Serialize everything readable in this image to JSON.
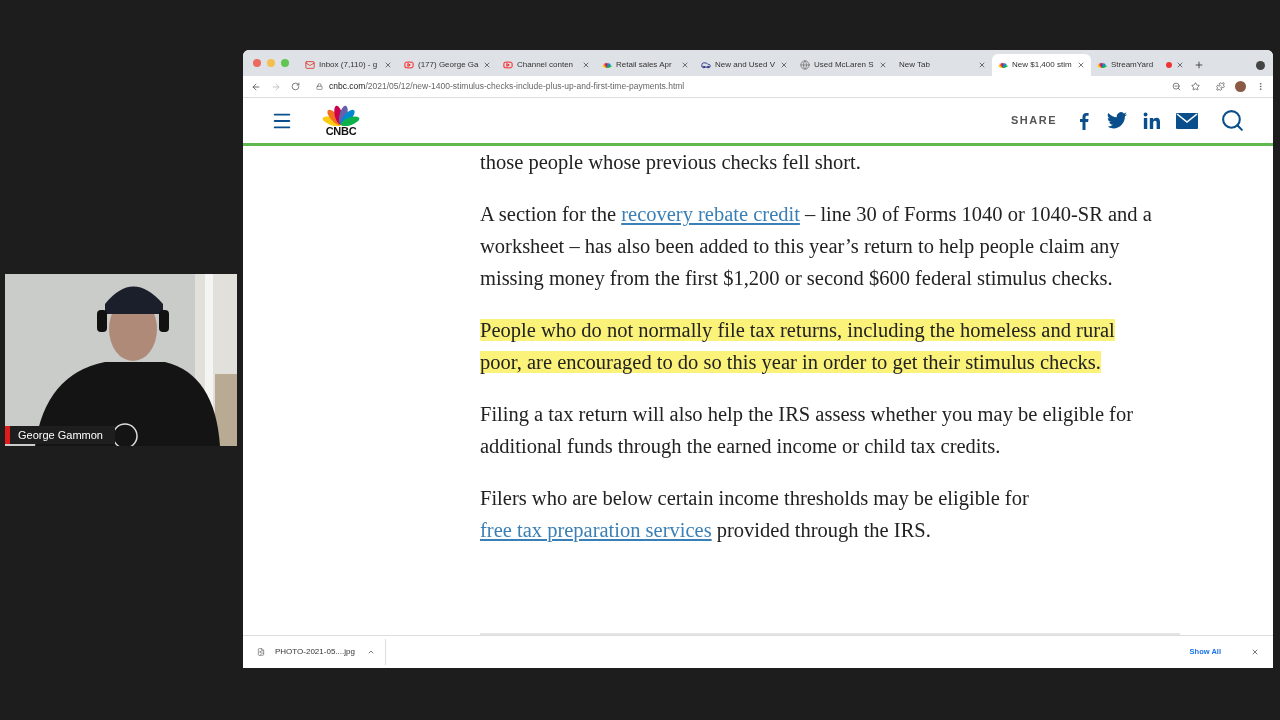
{
  "stream": {
    "presenter_name": "George Gammon"
  },
  "browser": {
    "tabs": [
      {
        "title": "Inbox (7,110) - g",
        "kind": "mail",
        "selected": false,
        "recording": false
      },
      {
        "title": "(177) George Ga",
        "kind": "video",
        "selected": false,
        "recording": false
      },
      {
        "title": "Channel conten",
        "kind": "video",
        "selected": false,
        "recording": false
      },
      {
        "title": "Retail sales Apr",
        "kind": "peacock",
        "selected": false,
        "recording": false
      },
      {
        "title": "New and Used V",
        "kind": "car",
        "selected": false,
        "recording": false
      },
      {
        "title": "Used McLaren S",
        "kind": "globe",
        "selected": false,
        "recording": false
      },
      {
        "title": "New Tab",
        "kind": "none",
        "selected": false,
        "recording": false
      },
      {
        "title": "New $1,400 stim",
        "kind": "peacock",
        "selected": true,
        "recording": false
      },
      {
        "title": "StreamYard",
        "kind": "peacock",
        "selected": false,
        "recording": true
      }
    ],
    "address": {
      "host": "cnbc.com",
      "path": "/2021/05/12/new-1400-stimulus-checks-include-plus-up-and-first-time-payments.html"
    },
    "site_header": {
      "logo": "CNBC",
      "share_label": "SHARE"
    },
    "article": {
      "paragraphs": [
        {
          "highlighted": false,
          "segments": [
            {
              "kind": "text",
              "text": "those people whose previous checks fell short."
            }
          ]
        },
        {
          "highlighted": false,
          "segments": [
            {
              "kind": "text",
              "text": "A section for the "
            },
            {
              "kind": "link",
              "text": "recovery rebate credit"
            },
            {
              "kind": "text",
              "text": " – line 30 of Forms 1040 or 1040-SR and a worksheet – has also been added to this year’s return to help people claim any missing money from the first $1,200 or second $600 federal stimulus checks."
            }
          ]
        },
        {
          "highlighted": true,
          "segments": [
            {
              "kind": "text",
              "text": "People who do not normally file tax returns, including the homeless and rural poor, are encouraged to do so this year in order to get their stimulus checks."
            }
          ]
        },
        {
          "highlighted": false,
          "segments": [
            {
              "kind": "text",
              "text": "Filing a tax return will also help the IRS assess whether you may be eligible for additional funds through the earned income or child tax credits."
            }
          ]
        },
        {
          "highlighted": false,
          "segments": [
            {
              "kind": "text",
              "text": "Filers who are below certain income thresholds may be eligible for "
            },
            {
              "kind": "link",
              "text": "free tax preparation services"
            },
            {
              "kind": "text",
              "text": " provided through the IRS."
            }
          ]
        }
      ]
    },
    "downloads": {
      "file": "PHOTO-2021-05....jpg",
      "show_all": "Show All"
    }
  }
}
